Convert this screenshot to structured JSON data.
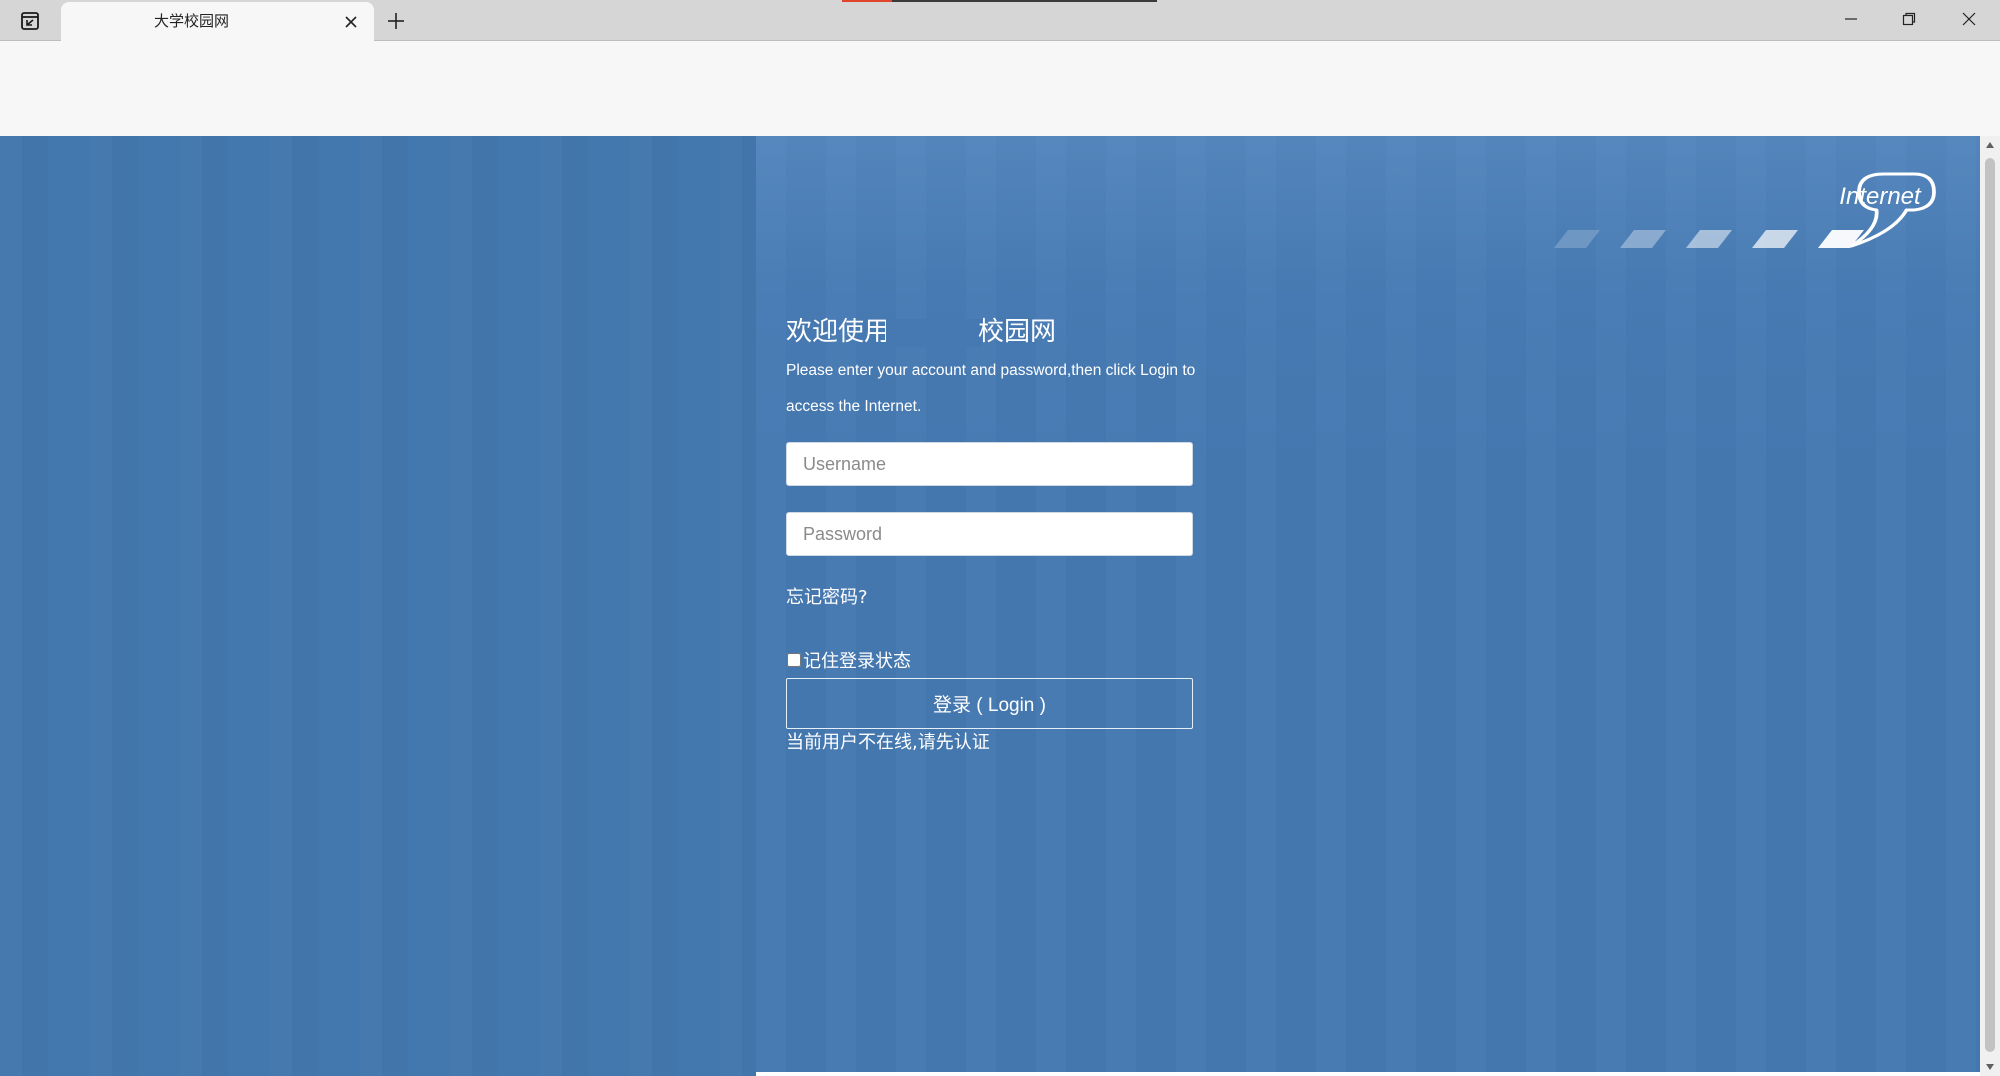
{
  "browser": {
    "tab_title": "大学校园网",
    "load_progress": 0.16,
    "accent_color": "#e0452c"
  },
  "login": {
    "title_prefix": "欢迎使用",
    "title_suffix": "校园网",
    "description": "Please enter your account and password,then click Login to access the Internet.",
    "username_placeholder": "Username",
    "password_placeholder": "Password",
    "forgot_password": "忘记密码?",
    "remember_me": "记住登录状态",
    "remember_checked": false,
    "login_button": "登录 ( Login )",
    "status": "当前用户不在线,请先认证"
  },
  "logo": {
    "text": "Internet"
  },
  "colors": {
    "page_background": "#4377ae",
    "panel_background": "#4679b2",
    "text": "#ffffff"
  },
  "icons": {
    "tab_actions": "tab-actions-icon",
    "close_tab": "close-icon",
    "new_tab": "plus-icon",
    "minimize": "minimize-icon",
    "restore": "restore-icon",
    "close_window": "close-icon",
    "scroll_up": "arrow-up-icon",
    "scroll_down": "arrow-down-icon"
  }
}
